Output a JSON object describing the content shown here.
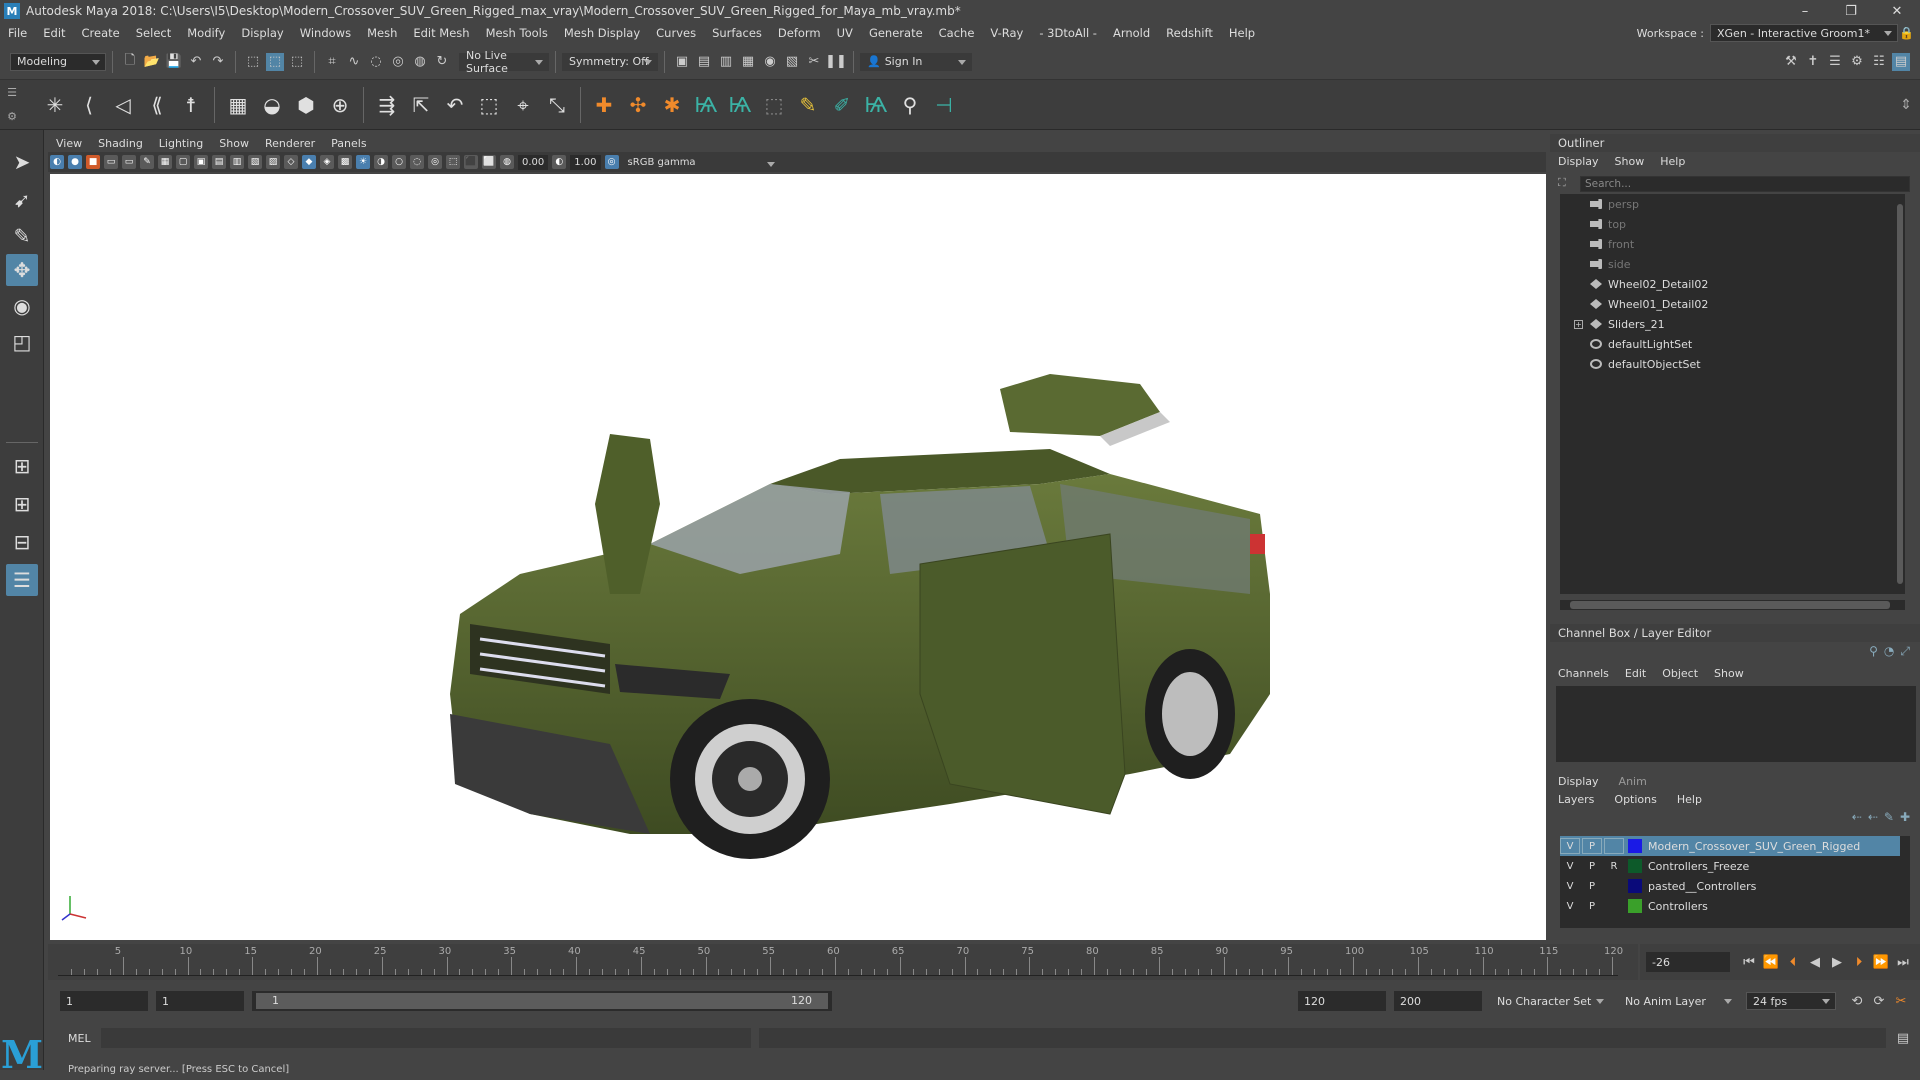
{
  "window": {
    "title": "Autodesk Maya 2018: C:\\Users\\I5\\Desktop\\Modern_Crossover_SUV_Green_Rigged_max_vray\\Modern_Crossover_SUV_Green_Rigged_for_Maya_mb_vray.mb*",
    "minimize": "–",
    "restore": "❐",
    "close": "✕"
  },
  "menubar": {
    "items": [
      "File",
      "Edit",
      "Create",
      "Select",
      "Modify",
      "Display",
      "Windows",
      "Mesh",
      "Edit Mesh",
      "Mesh Tools",
      "Mesh Display",
      "Curves",
      "Surfaces",
      "Deform",
      "UV",
      "Generate",
      "Cache",
      "V-Ray",
      "- 3DtoAll -",
      "Arnold",
      "Redshift",
      "Help"
    ],
    "workspace_label": "Workspace :",
    "workspace_value": "XGen - Interactive Groom1*"
  },
  "statusline": {
    "mode": "Modeling",
    "live_surface": "No Live Surface",
    "symmetry": "Symmetry: Off",
    "sign_in": "Sign In"
  },
  "viewport": {
    "menu": [
      "View",
      "Shading",
      "Lighting",
      "Show",
      "Renderer",
      "Panels"
    ],
    "exposure": "0.00",
    "gamma": "1.00",
    "color_space": "sRGB gamma"
  },
  "outliner": {
    "title": "Outliner",
    "menu": [
      "Display",
      "Show",
      "Help"
    ],
    "search_placeholder": "Search...",
    "items": [
      {
        "name": "persp",
        "type": "cam",
        "dim": true
      },
      {
        "name": "top",
        "type": "cam",
        "dim": true
      },
      {
        "name": "front",
        "type": "cam",
        "dim": true
      },
      {
        "name": "side",
        "type": "cam",
        "dim": true
      },
      {
        "name": "Wheel02_Detail02",
        "type": "xf",
        "dim": false
      },
      {
        "name": "Wheel01_Detail02",
        "type": "xf",
        "dim": false
      },
      {
        "name": "Sliders_21",
        "type": "xf",
        "dim": false,
        "expander": "+"
      },
      {
        "name": "defaultLightSet",
        "type": "set",
        "dim": false
      },
      {
        "name": "defaultObjectSet",
        "type": "set",
        "dim": false
      }
    ]
  },
  "channelbox": {
    "title": "Channel Box / Layer Editor",
    "menu": [
      "Channels",
      "Edit",
      "Object",
      "Show"
    ],
    "layer_tabs": [
      "Display",
      "Anim"
    ],
    "layer_menu": [
      "Layers",
      "Options",
      "Help"
    ],
    "layers": [
      {
        "v": "V",
        "p": "P",
        "r": "",
        "name": "Modern_Crossover_SUV_Green_Rigged",
        "color": "#1a1ae6",
        "selected": true
      },
      {
        "v": "V",
        "p": "P",
        "r": "R",
        "name": "Controllers_Freeze",
        "color": "#0d5a2a",
        "selected": false
      },
      {
        "v": "V",
        "p": "P",
        "r": "",
        "name": "pasted__Controllers",
        "color": "#0a0a7a",
        "selected": false
      },
      {
        "v": "V",
        "p": "P",
        "r": "",
        "name": "Controllers",
        "color": "#3aa02a",
        "selected": false
      }
    ]
  },
  "timeline": {
    "ticks": [
      "5",
      "10",
      "15",
      "20",
      "25",
      "30",
      "35",
      "40",
      "45",
      "50",
      "55",
      "60",
      "65",
      "70",
      "75",
      "80",
      "85",
      "90",
      "95",
      "100",
      "105",
      "110",
      "115",
      "120"
    ],
    "current_frame": "-26"
  },
  "range": {
    "start": "1",
    "playback_start": "1",
    "slider_start": "1",
    "slider_end": "120",
    "playback_end": "120",
    "end": "200",
    "character_set": "No Character Set",
    "anim_layer": "No Anim Layer",
    "fps": "24 fps"
  },
  "mel": {
    "label": "MEL"
  },
  "helpline": {
    "text": "Preparing ray server... [Press ESC to Cancel]"
  },
  "colors": {
    "accent": "#5285a6",
    "car_body": "#4b5b2a",
    "maya_logo": "#2a9fd6"
  }
}
